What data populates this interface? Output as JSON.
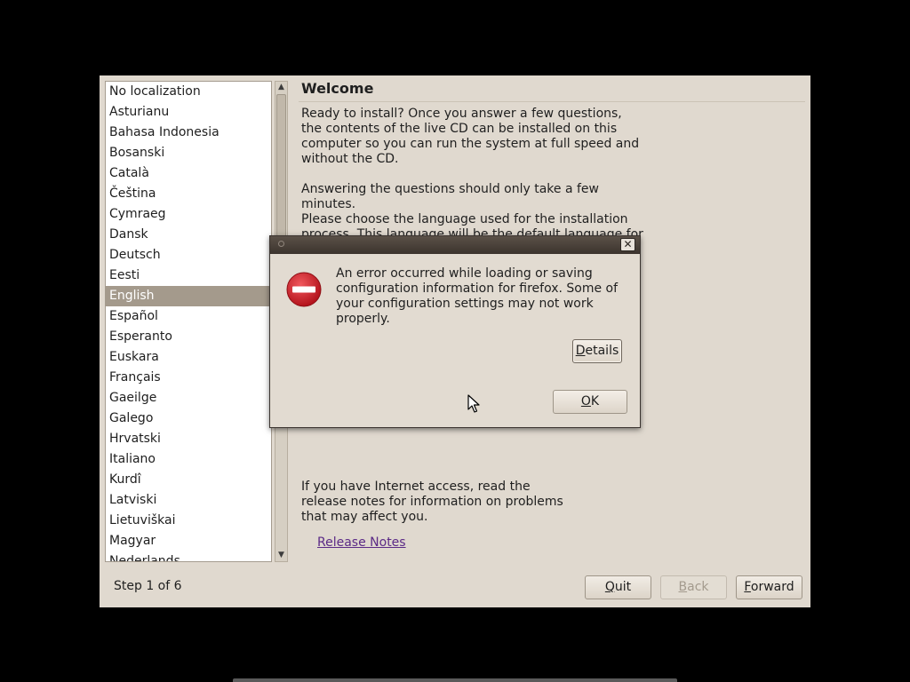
{
  "languages": {
    "items": [
      "No localization",
      "Asturianu",
      "Bahasa Indonesia",
      "Bosanski",
      "Català",
      "Čeština",
      "Cymraeg",
      "Dansk",
      "Deutsch",
      "Eesti",
      "English",
      "Español",
      "Esperanto",
      "Euskara",
      "Français",
      "Gaeilge",
      "Galego",
      "Hrvatski",
      "Italiano",
      "Kurdî",
      "Latviski",
      "Lietuviškai",
      "Magyar",
      "Nederlands"
    ],
    "selected": "English"
  },
  "welcome": {
    "title": "Welcome",
    "para1": "Ready to install? Once you answer a few questions, the contents of the live CD can be installed on this computer so you can run the system at full speed and without the CD.",
    "para2": "Answering the questions should only take a few minutes.",
    "para3": "Please choose the language used for the installation process. This language will be the default language for the",
    "para4": "If you have Internet access, read the release notes for information on problems that may affect you.",
    "release_notes": "Release Notes"
  },
  "footer": {
    "step": "Step 1 of 6",
    "quit_mn": "Q",
    "quit_rest": "uit",
    "back_mn": "B",
    "back_rest": "ack",
    "forward_mn": "F",
    "forward_rest": "orward"
  },
  "dialog": {
    "message": "An error occurred while loading or saving configuration information for firefox. Some of your configuration settings may not work properly.",
    "details_mn": "D",
    "details_rest": "etails",
    "ok_mn": "O",
    "ok_rest": "K",
    "close_glyph": "✕"
  },
  "icons": {
    "error": "error-icon",
    "close": "close-icon",
    "cursor": "mouse-pointer-icon"
  },
  "colors": {
    "selection": "#a49a8c",
    "background": "#e0d9cf",
    "error_red": "#d8202a",
    "link": "#5b2a86"
  }
}
